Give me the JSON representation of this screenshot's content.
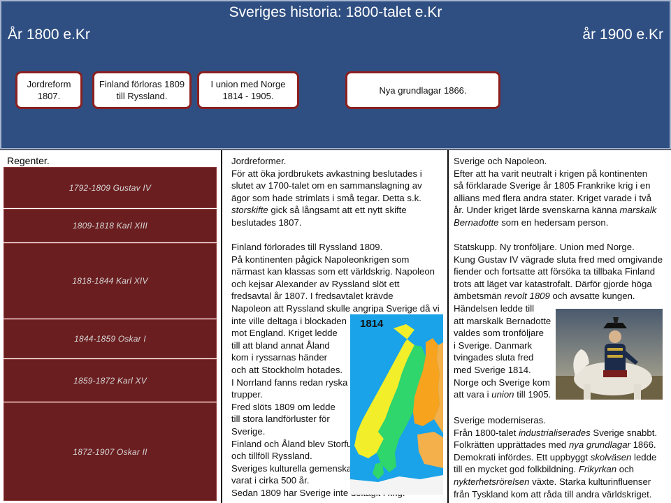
{
  "banner": {
    "title": "Sveriges historia: 1800-talet e.Kr",
    "year_start": "År 1800 e.Kr",
    "year_end": "år 1900 e.Kr"
  },
  "timeline_events": [
    [
      "Jordreform",
      "1807."
    ],
    [
      "Finland förloras 1809",
      "till Ryssland."
    ],
    [
      "I union med Norge",
      "1814 - 1905."
    ],
    [
      "Nya grundlagar 1866."
    ]
  ],
  "regents": {
    "title": "Regenter.",
    "items": [
      "1792-1809 Gustav IV",
      "1809-1818 Karl XIII",
      "1818-1844 Karl XIV",
      "1844-1859 Oskar I",
      "1859-1872 Karl XV",
      "1872-1907 Oskar II"
    ]
  },
  "middle": {
    "reform_heading": "Jordreformer.",
    "reform_lines": [
      "För att öka jordbrukets avkastning beslutades i",
      "slutet av 1700-talet om en sammanslagning av",
      "ägor som hade strimlats i små tegar. Detta s.k.",
      "storskifte gick så långsamt att ett nytt skifte",
      "beslutades 1807."
    ],
    "reform_italic_word": "storskifte",
    "reform_line4_rest": " gick så långsamt att ett nytt skifte",
    "finland_heading": "Finland förlorades till Ryssland 1809.",
    "finland_lines": [
      "På kontinenten pågick Napoleonkrigen som",
      "närmast kan klassas som ett världskrig. Napoleon",
      "och kejsar Alexander av Ryssland slöt ett",
      "fredsavtal år 1807. I fredsavtalet krävde",
      "Napoleon att Ryssland skulle angripa Sverige då vi",
      "inte ville deltaga i blockaden",
      "mot England. Kriget ledde",
      "till att bland annat Åland",
      "kom i ryssarnas händer",
      "och att Stockholm hotades.",
      "I Norrland fanns redan ryska",
      "trupper.",
      "Fred slöts 1809 om ledde",
      "till stora landförluster för",
      "Sverige.",
      "Finland och Åland blev  Storfurstendömet Finland",
      "och tillföll Ryssland.",
      "Sveriges kulturella gemenskap med Finland hade",
      "varat i cirka 500 år.",
      "Sedan 1809 har Sverige inte deltagit i krig."
    ],
    "map_label": "1814"
  },
  "right": {
    "napoleon_heading": "Sverige och Napoleon.",
    "napoleon_lines": [
      "Efter att ha varit neutralt i krigen på kontinenten",
      "så förklarade Sverige år 1805 Frankrike krig i en",
      "allians med flera andra stater. Kriget varade i två",
      "år. Under kriget lärde svenskarna känna "
    ],
    "napoleon_italic_1": "marskalk",
    "napoleon_italic_2": "Bernadotte",
    "napoleon_line5_rest": " som en hedersam person.",
    "coup_heading": "Statskupp. Ny tronföljare. Union med Norge.",
    "coup_lines": [
      "Kung Gustav IV vägrade sluta fred med omgivande",
      "fiender och fortsatte att försöka ta tillbaka Finland",
      "trots att läget var katastrofalt. Därför gjorde höga",
      "ämbetsmän ",
      "Händelsen ledde till",
      "att marskalk Bernadotte",
      "valdes som tronföljare",
      "i Sverige.  Danmark",
      "tvingades sluta fred",
      "med Sverige 1814.",
      "Norge och Sverige kom",
      "att vara i "
    ],
    "coup_italic_revolt": "revolt 1809",
    "coup_revolt_rest": " och avsatte kungen.",
    "coup_italic_union": "union",
    "coup_union_rest": " till 1905.",
    "modern_heading": "Sverige moderniseras.",
    "modern_l1a": "Från 1800-talet ",
    "modern_l1i": "industrialiserades",
    "modern_l1b": " Sverige snabbt.",
    "modern_l2a": "Folkrätten upprättades med ",
    "modern_l2i": "nya grundlagar",
    "modern_l2b": " 1866.",
    "modern_l3a": "Demokrati infördes. Ett uppbyggt ",
    "modern_l3i": "skolväsen",
    "modern_l3b": " ledde",
    "modern_l4a": "till en mycket god folkbildning. ",
    "modern_l4i": "Frikyrkan",
    "modern_l4b": " och",
    "modern_l5i": "nykterhetsrörelsen",
    "modern_l5b": " växte. Starka kulturinfluenser",
    "modern_l6": "från Tyskland kom att råda till andra världskriget."
  }
}
